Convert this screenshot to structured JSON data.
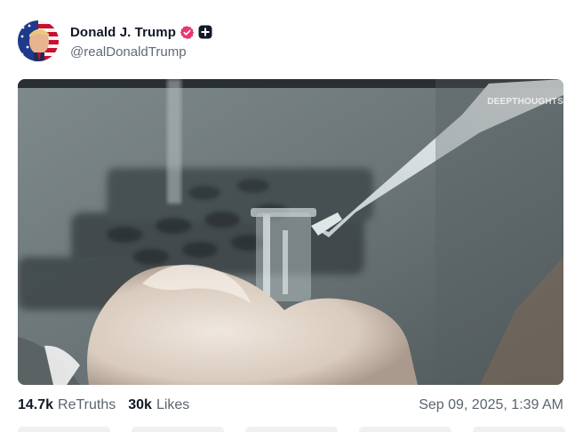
{
  "author": {
    "display_name": "Donald J. Trump",
    "handle": "@realDonaldTrump",
    "avatar_icon": "flag-portrait-avatar",
    "verified_icon": "verified-badge-icon",
    "plus_icon": "subscription-plus-icon"
  },
  "media": {
    "watermark": "DEEPTHOUGHTS"
  },
  "stats": {
    "retruths_count": "14.7k",
    "retruths_label": "ReTruths",
    "likes_count": "30k",
    "likes_label": "Likes"
  },
  "timestamp": "Sep 09, 2025, 1:39 AM",
  "colors": {
    "verified": "#e5396f",
    "text_primary": "#111827",
    "text_secondary": "#5b6471"
  }
}
